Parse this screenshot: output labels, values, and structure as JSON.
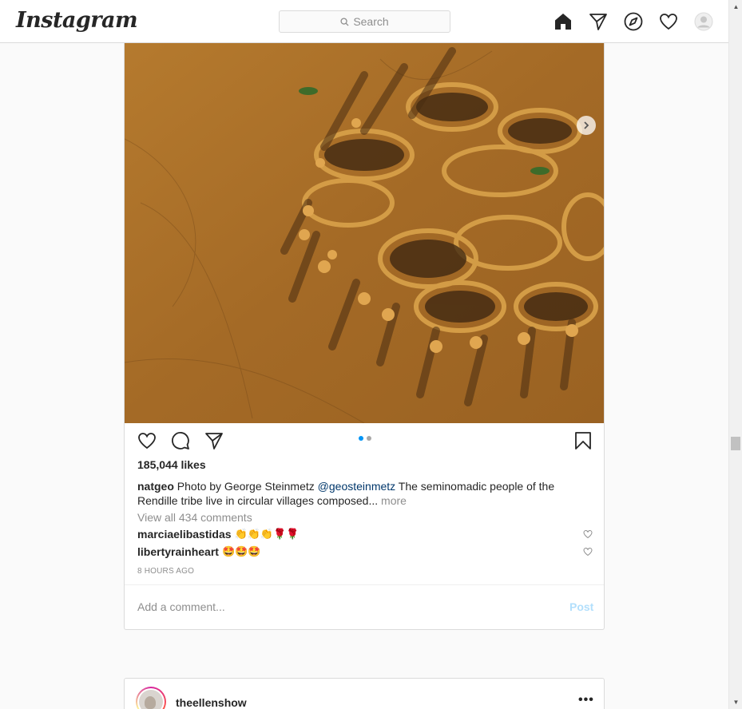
{
  "nav": {
    "logo": "Instagram",
    "search_placeholder": "Search",
    "icons": [
      "home-icon",
      "direct-icon",
      "explore-icon",
      "activity-icon",
      "profile-icon"
    ]
  },
  "post": {
    "image_alt": "Aerial view of circular Rendille villages in the desert",
    "carousel": {
      "count": 2,
      "active": 1
    },
    "likes": "185,044 likes",
    "caption": {
      "user": "natgeo",
      "text_before": "Photo by George Steinmetz",
      "mention": "@geosteinmetz",
      "text_after": "The seminomadic people of the Rendille tribe live in circular villages composed...",
      "more": "more"
    },
    "view_all": "View all 434 comments",
    "comments": [
      {
        "user": "marciaelibastidas",
        "text": "👏👏👏🌹🌹"
      },
      {
        "user": "libertyrainheart",
        "text": "🤩🤩🤩"
      }
    ],
    "time": "8 HOURS AGO",
    "add_comment_placeholder": "Add a comment...",
    "post_button": "Post"
  },
  "next_post": {
    "user": "theellenshow",
    "more": "•••"
  },
  "colors": {
    "accent": "#0095f6",
    "link": "#00376b",
    "muted": "#8e8e8e",
    "border": "#dbdbdb"
  }
}
